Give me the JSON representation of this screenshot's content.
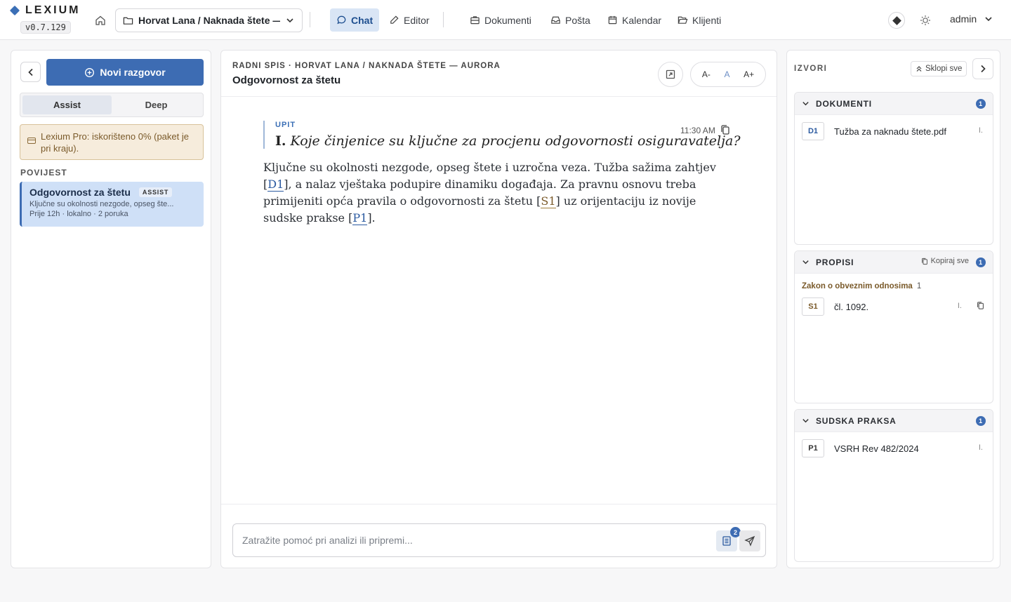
{
  "app": {
    "name": "LEXIUM",
    "version": "v0.7.129",
    "case_selector": "Horvat Lana / Naknada štete — ...",
    "nav": [
      {
        "label": "Chat",
        "active": true
      },
      {
        "label": "Editor",
        "active": false
      },
      {
        "label": "Dokumenti",
        "active": false
      },
      {
        "label": "Pošta",
        "active": false
      },
      {
        "label": "Kalendar",
        "active": false
      },
      {
        "label": "Klijenti",
        "active": false
      }
    ],
    "user": "admin"
  },
  "sidebar": {
    "new_conversation": "Novi razgovor",
    "modes": [
      {
        "label": "Assist",
        "active": true
      },
      {
        "label": "Deep",
        "active": false
      }
    ],
    "quota_notice": "Lexium Pro: iskorišteno 0% (paket je pri kraju).",
    "history_label": "POVIJEST",
    "history": [
      {
        "title": "Odgovornost za štetu",
        "badge": "ASSIST",
        "snippet": "Ključne su okolnosti nezgode, opseg šte...",
        "meta": "Prije 12h · lokalno · 2 poruka"
      }
    ]
  },
  "chat": {
    "breadcrumb": "RADNI SPIS · HORVAT LANA / NAKNADA ŠTETE — AURORA",
    "title": "Odgovornost za štetu",
    "font_controls": {
      "decrease": "A-",
      "normal": "A",
      "increase": "A+"
    },
    "query": {
      "label": "UPIT",
      "number": "I.",
      "text": "Koje činjenice su ključne za procjenu odgovornosti osiguravatelja?",
      "time": "11:30 AM"
    },
    "answer": {
      "p1": "Ključne su okolnosti nezgode, opseg štete i uzročna veza. Tužba sažima zahtjev [",
      "c1": "D1",
      "p2": "], a nalaz vještaka podupire dinamiku događaja. Za pravnu osnovu treba primijeniti opća pravila o odgovornosti za štetu [",
      "c2": "S1",
      "p3": "] uz orijentaciju iz novije sudske prakse [",
      "c3": "P1",
      "p4": "]."
    },
    "composer_placeholder": "Zatražite pomoć pri analizi ili pripremi...",
    "attached_docs_count": "2"
  },
  "sources": {
    "title": "IZVORI",
    "collapse_all": "Sklopi sve",
    "sections": {
      "documents": {
        "label": "DOKUMENTI",
        "count": "1",
        "items": [
          {
            "tag": "D1",
            "name": "Tužba za naknadu štete.pdf",
            "mark": "I."
          }
        ]
      },
      "regulations": {
        "label": "PROPISI",
        "count": "1",
        "copy_all": "Kopiraj sve",
        "law": "Zakon o obveznim odnosima",
        "law_count": "1",
        "items": [
          {
            "tag": "S1",
            "name": "čl. 1092.",
            "mark": "I."
          }
        ]
      },
      "case_law": {
        "label": "SUDSKA PRAKSA",
        "count": "1",
        "items": [
          {
            "tag": "P1",
            "name": "VSRH Rev 482/2024",
            "mark": "I."
          }
        ]
      }
    }
  }
}
